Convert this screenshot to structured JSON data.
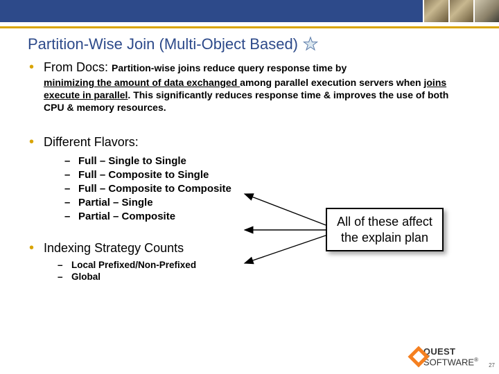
{
  "title": "Partition-Wise Join (Multi-Object Based)",
  "bullets": {
    "docs": {
      "lead": "From Docs: ",
      "tail": "Partition-wise joins reduce query response time by",
      "cont_pre": "minimizing the amount of data exchanged ",
      "cont_mid": "among parallel execution servers when ",
      "cont_u2": "joins execute in parallel",
      "cont_post": ". This significantly reduces response time & improves the use of both CPU & memory resources."
    },
    "flavors": {
      "label": "Different Flavors:",
      "items": [
        "Full – Single to Single",
        "Full – Composite to Single",
        "Full – Composite to Composite",
        "Partial – Single",
        "Partial – Composite"
      ]
    },
    "indexing": {
      "label": "Indexing Strategy Counts",
      "items": [
        "Local Prefixed/Non-Prefixed",
        "Global"
      ]
    }
  },
  "callout": "All of these affect the explain plan",
  "logo": {
    "brand": "QUEST",
    "suffix": "SOFTWARE",
    "reg": "®"
  },
  "page_number": "27"
}
